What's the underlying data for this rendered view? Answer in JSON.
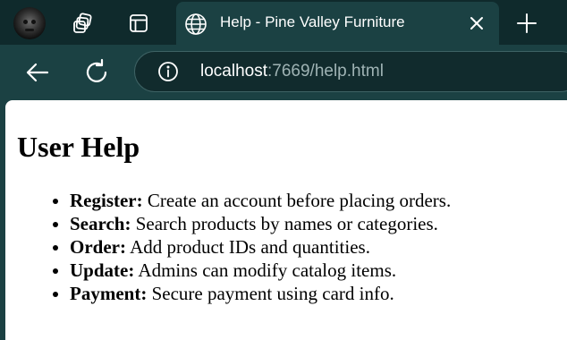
{
  "browser": {
    "tab_title": "Help - Pine Valley Furniture",
    "url_host": "localhost",
    "url_path": ":7669/help.html"
  },
  "page": {
    "heading": "User Help",
    "items": [
      {
        "term": "Register:",
        "text": " Create an account before placing orders."
      },
      {
        "term": "Search:",
        "text": " Search products by names or categories."
      },
      {
        "term": "Order:",
        "text": " Add product IDs and quantities."
      },
      {
        "term": "Update:",
        "text": " Admins can modify catalog items."
      },
      {
        "term": "Payment:",
        "text": " Secure payment using card info."
      }
    ]
  },
  "icons": {
    "avatar": "profile-avatar",
    "workspaces": "workspaces-icon",
    "tab_actions": "tab-actions-icon",
    "favicon": "globe-icon",
    "close": "close-icon",
    "new_tab": "plus-icon",
    "back": "back-arrow-icon",
    "reload": "reload-icon",
    "site_info": "info-icon"
  },
  "colors": {
    "tabbar": "#0f2a2c",
    "toolbar": "#1b4143",
    "page_bg": "#ffffff"
  }
}
